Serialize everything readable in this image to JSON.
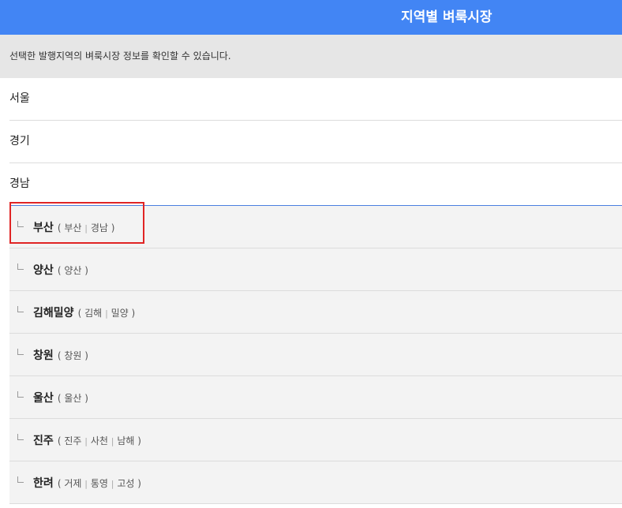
{
  "header": {
    "title": "지역별 벼룩시장"
  },
  "notice": {
    "text": "선택한 발행지역의 벼룩시장 정보를 확인할 수 있습니다."
  },
  "regions": [
    {
      "label": "서울"
    },
    {
      "label": "경기"
    },
    {
      "label": "경남"
    }
  ],
  "subregions": [
    {
      "name": "부산",
      "open": "(",
      "close": ")",
      "areas": [
        "부산",
        "경남"
      ]
    },
    {
      "name": "양산",
      "open": "(",
      "close": ")",
      "areas": [
        "양산"
      ]
    },
    {
      "name": "김해밀양",
      "open": "(",
      "close": ")",
      "areas": [
        "김해",
        "밀양"
      ]
    },
    {
      "name": "창원",
      "open": "(",
      "close": ")",
      "areas": [
        "창원"
      ]
    },
    {
      "name": "울산",
      "open": "(",
      "close": ")",
      "areas": [
        "울산"
      ]
    },
    {
      "name": "진주",
      "open": "(",
      "close": ")",
      "areas": [
        "진주",
        "사천",
        "남해"
      ]
    },
    {
      "name": "한려",
      "open": "(",
      "close": ")",
      "areas": [
        "거제",
        "통영",
        "고성"
      ]
    }
  ],
  "separator": "|",
  "colors": {
    "header_bg": "#4285f4",
    "notice_bg": "#e6e6e6",
    "sub_bg": "#f3f3f3",
    "highlight": "#e02424"
  }
}
